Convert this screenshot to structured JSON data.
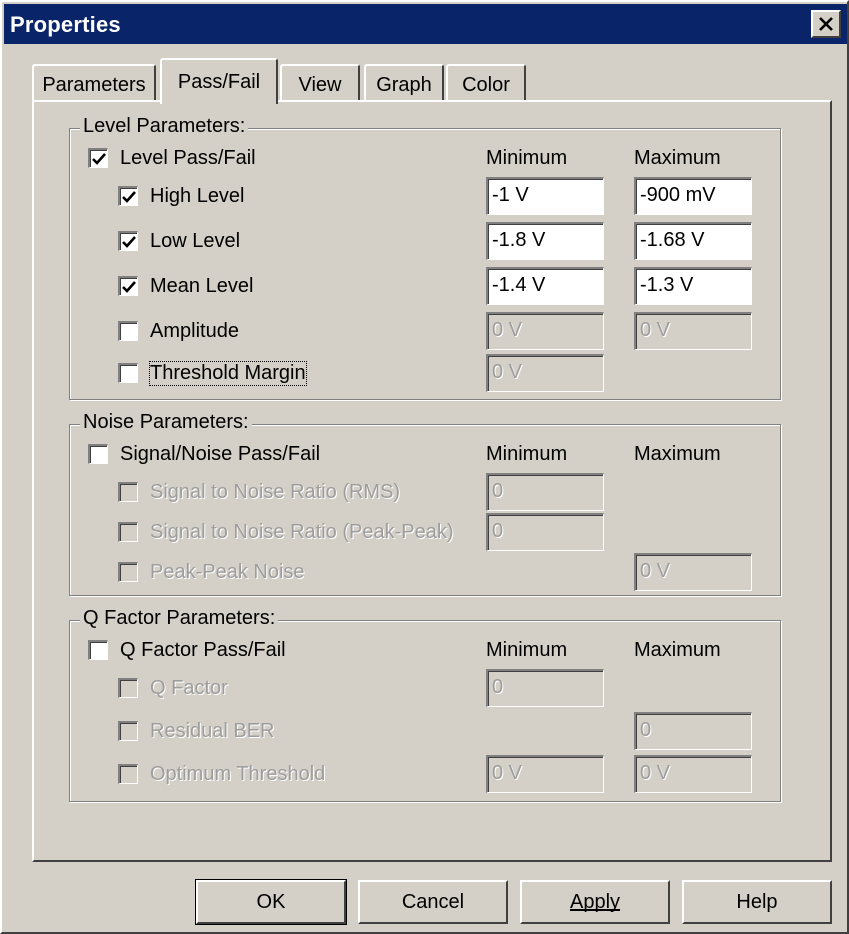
{
  "window": {
    "title": "Properties",
    "close_icon": "close-icon"
  },
  "tabs": [
    {
      "label": "Parameters"
    },
    {
      "label": "Pass/Fail",
      "active": true
    },
    {
      "label": "View"
    },
    {
      "label": "Graph"
    },
    {
      "label": "Color"
    }
  ],
  "level": {
    "group_label": "Level Parameters:",
    "master_label": "Level Pass/Fail",
    "master_checked": true,
    "min_header": "Minimum",
    "max_header": "Maximum",
    "rows": [
      {
        "label": "High Level",
        "checked": true,
        "min": "-1 V",
        "max": "-900 mV"
      },
      {
        "label": "Low Level",
        "checked": true,
        "min": "-1.8 V",
        "max": "-1.68 V"
      },
      {
        "label": "Mean Level",
        "checked": true,
        "min": "-1.4 V",
        "max": "-1.3 V"
      },
      {
        "label": "Amplitude",
        "checked": false,
        "min": "0 V",
        "max": "0 V"
      },
      {
        "label": "Threshold Margin",
        "checked": false,
        "min": "0 V"
      }
    ]
  },
  "noise": {
    "group_label": "Noise Parameters:",
    "master_label": "Signal/Noise Pass/Fail",
    "master_checked": false,
    "min_header": "Minimum",
    "max_header": "Maximum",
    "rows": [
      {
        "label": "Signal to Noise Ratio (RMS)",
        "min": "0"
      },
      {
        "label": "Signal to Noise Ratio (Peak-Peak)",
        "min": "0"
      },
      {
        "label": "Peak-Peak Noise",
        "max": "0 V"
      }
    ]
  },
  "qfactor": {
    "group_label": "Q Factor Parameters:",
    "master_label": "Q Factor Pass/Fail",
    "master_checked": false,
    "min_header": "Minimum",
    "max_header": "Maximum",
    "rows": [
      {
        "label": "Q Factor",
        "min": "0"
      },
      {
        "label": "Residual BER",
        "max": "0"
      },
      {
        "label": "Optimum Threshold",
        "min": "0 V",
        "max": "0 V"
      }
    ]
  },
  "buttons": {
    "ok": "OK",
    "cancel": "Cancel",
    "apply": "Apply",
    "help": "Help"
  }
}
